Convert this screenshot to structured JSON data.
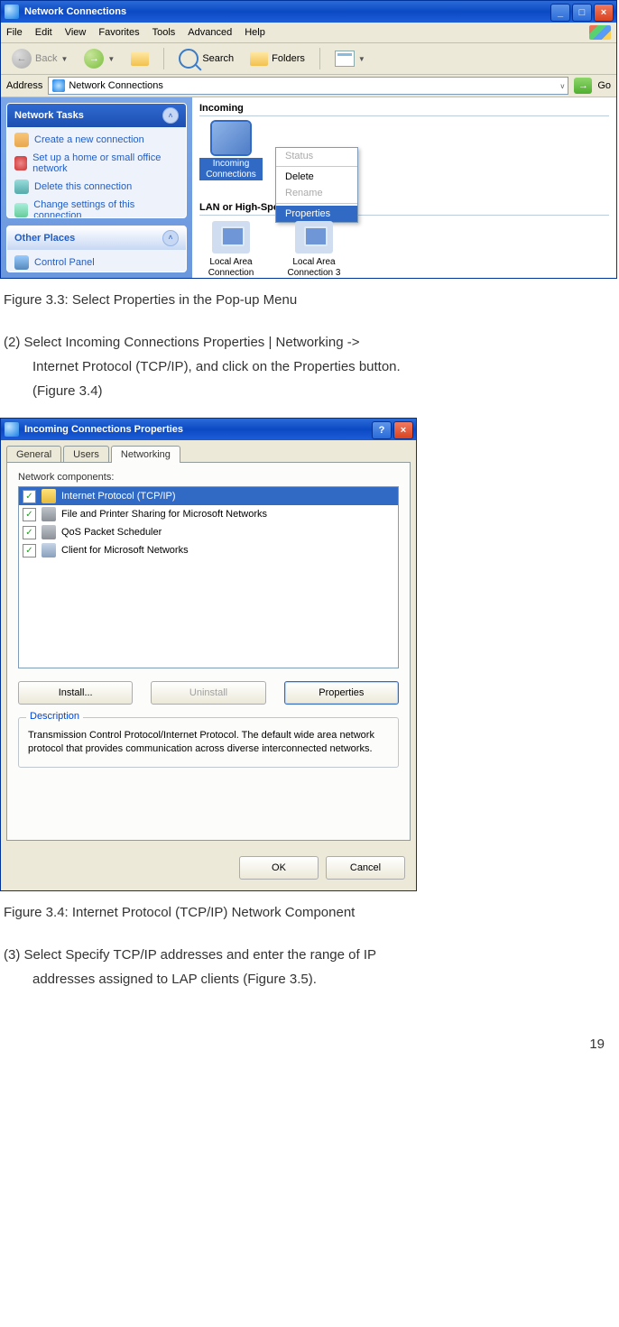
{
  "fig33": {
    "title": "Network Connections",
    "menus": [
      "File",
      "Edit",
      "View",
      "Favorites",
      "Tools",
      "Advanced",
      "Help"
    ],
    "toolbar": {
      "back": "Back",
      "search": "Search",
      "folders": "Folders"
    },
    "address_label": "Address",
    "address_value": "Network Connections",
    "go_label": "Go",
    "sidepanel": {
      "tasks_header": "Network Tasks",
      "tasks": [
        "Create a new connection",
        "Set up a home or small office network",
        "Delete this connection",
        "Change settings of this connection"
      ],
      "other_header": "Other Places",
      "other_items": [
        "Control Panel"
      ]
    },
    "folder": {
      "group1": "Incoming",
      "incoming_label": "Incoming Connections",
      "group2": "LAN or High-Speed Internet",
      "lan1": "Local Area Connection",
      "lan2": "Local Area Connection 3"
    },
    "context_menu": {
      "status": "Status",
      "delete": "Delete",
      "rename": "Rename",
      "properties": "Properties"
    }
  },
  "caption33": "Figure 3.3: Select Properties in the Pop-up Menu",
  "step2_line1": "(2) Select Incoming Connections Properties | Networking ->",
  "step2_line2": "Internet Protocol (TCP/IP), and click on the Properties button.",
  "step2_line3": "(Figure 3.4)",
  "fig34": {
    "title": "Incoming Connections Properties",
    "tabs": [
      "General",
      "Users",
      "Networking"
    ],
    "components_label": "Network components:",
    "components": [
      "Internet Protocol (TCP/IP)",
      "File and Printer Sharing for Microsoft Networks",
      "QoS Packet Scheduler",
      "Client for Microsoft Networks"
    ],
    "install_btn": "Install...",
    "uninstall_btn": "Uninstall",
    "properties_btn": "Properties",
    "desc_legend": "Description",
    "desc_text": "Transmission Control Protocol/Internet Protocol. The default wide area network protocol that provides communication across diverse interconnected networks.",
    "ok": "OK",
    "cancel": "Cancel"
  },
  "caption34": "Figure 3.4: Internet Protocol (TCP/IP) Network Component",
  "step3_line1": "(3) Select Specify TCP/IP addresses and enter the range of IP",
  "step3_line2": "addresses assigned to LAP clients (Figure 3.5).",
  "page_number": "19"
}
